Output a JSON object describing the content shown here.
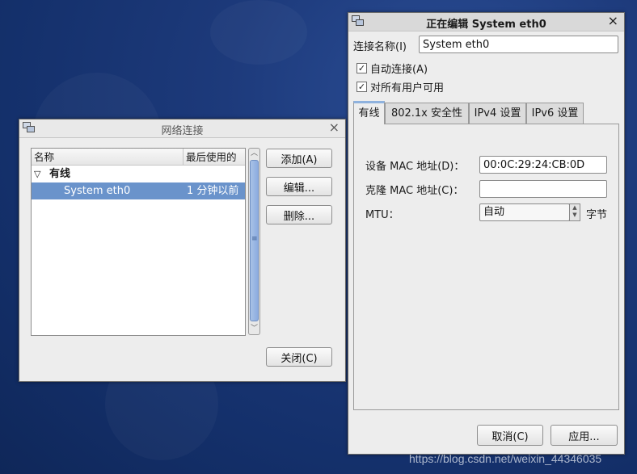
{
  "watermark": "https://blog.csdn.net/weixin_44346035",
  "connections_window": {
    "title": "网络连接",
    "columns": {
      "name": "名称",
      "last_used": "最后使用的"
    },
    "group_label": "有线",
    "rows": [
      {
        "name": "System eth0",
        "last_used": "1 分钟以前"
      }
    ],
    "buttons": {
      "add": "添加(A)",
      "edit": "编辑...",
      "delete": "删除...",
      "close": "关闭(C)"
    }
  },
  "edit_window": {
    "title": "正在编辑 System eth0",
    "connection_name_label": "连接名称(I)",
    "connection_name_value": "System eth0",
    "auto_connect_label": "自动连接(A)",
    "auto_connect_checked": true,
    "all_users_label": "对所有用户可用",
    "all_users_checked": true,
    "tabs": [
      "有线",
      "802.1x 安全性",
      "IPv4 设置",
      "IPv6 设置"
    ],
    "active_tab": "有线",
    "device_mac_label": "设备 MAC 地址(D)：",
    "device_mac_value": "00:0C:29:24:CB:0D",
    "cloned_mac_label": "克隆 MAC 地址(C)：",
    "cloned_mac_value": "",
    "mtu_label": "MTU：",
    "mtu_value": "自动",
    "mtu_unit": "字节",
    "buttons": {
      "cancel": "取消(C)",
      "apply": "应用..."
    }
  }
}
